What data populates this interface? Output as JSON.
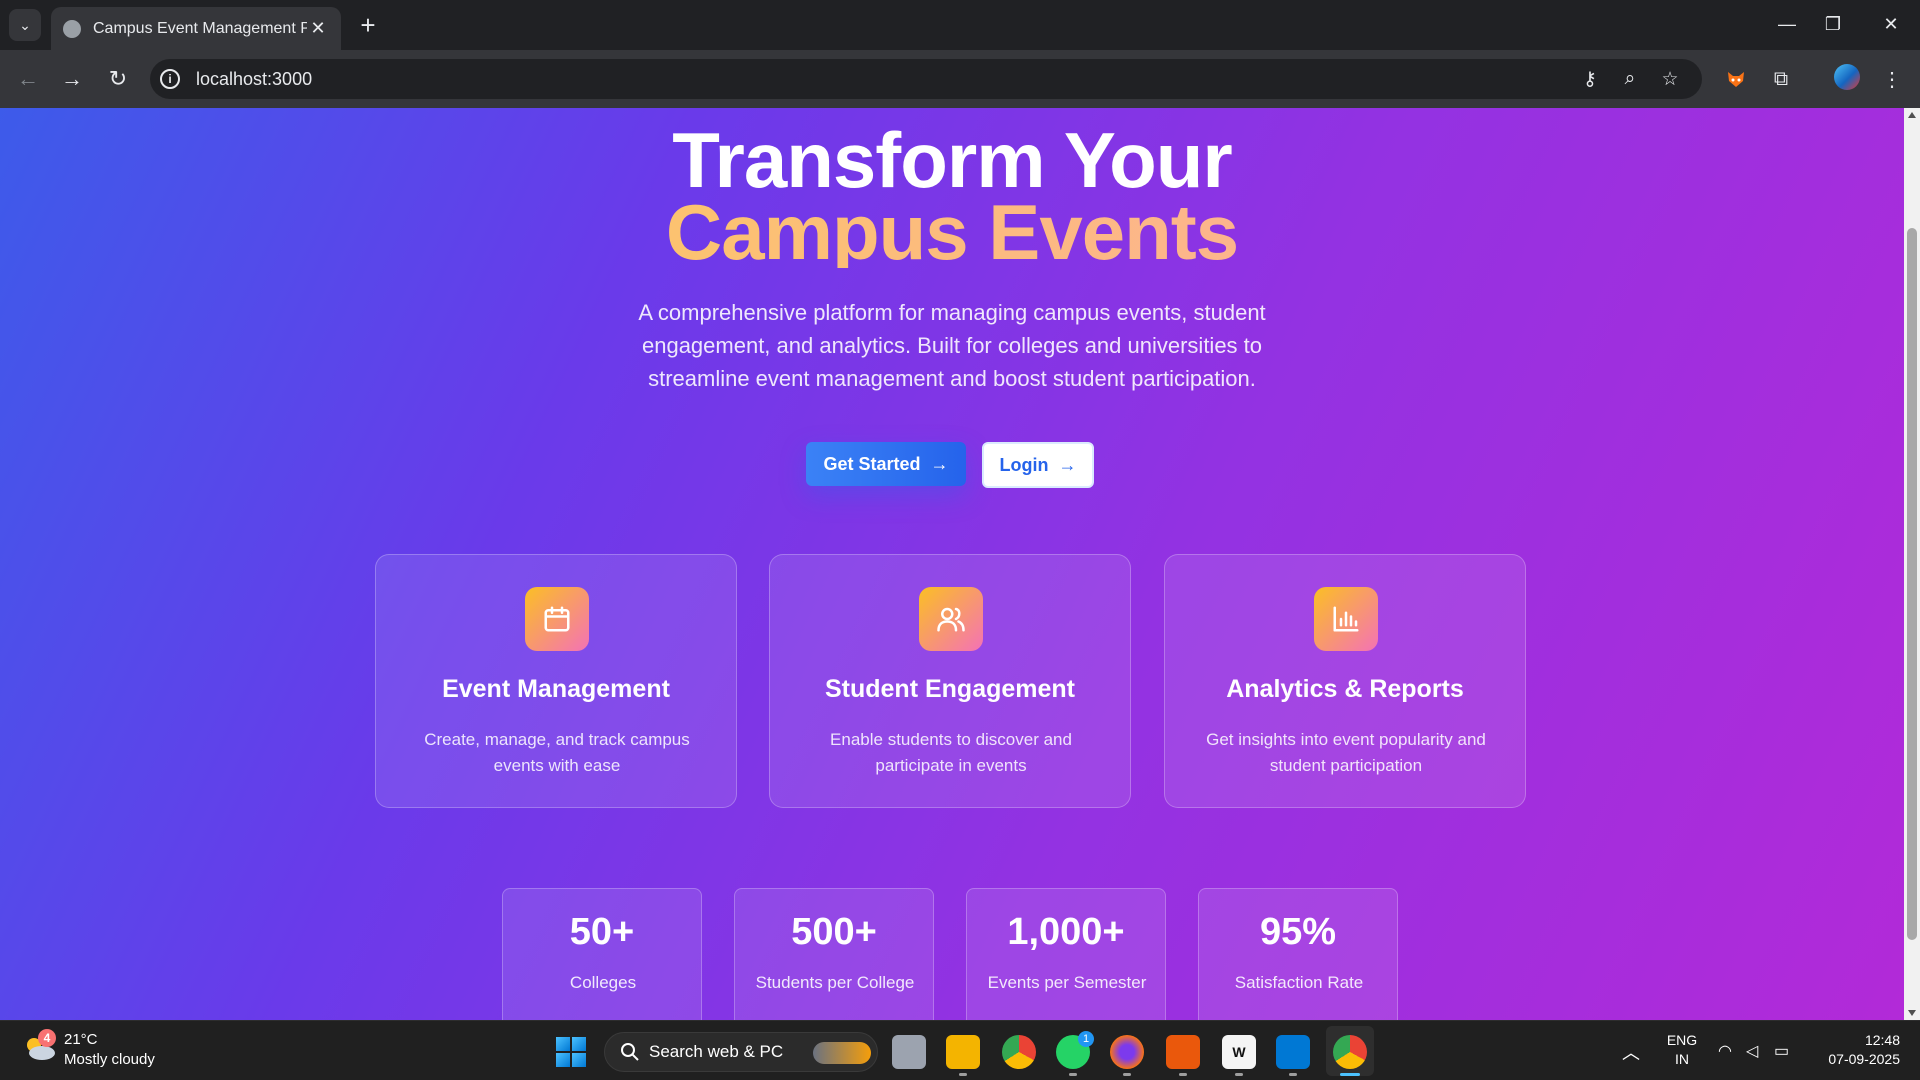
{
  "browser": {
    "tab_title": "Campus Event Management Pla",
    "url": "localhost:3000"
  },
  "hero": {
    "title_line1": "Transform Your",
    "title_line2": "Campus Events",
    "description": "A comprehensive platform for managing campus events, student engagement, and analytics. Built for colleges and universities to streamline event management and boost student participation.",
    "primary_button": "Get Started",
    "secondary_button": "Login"
  },
  "features": [
    {
      "icon": "calendar-icon",
      "title": "Event Management",
      "description": "Create, manage, and track campus events with ease"
    },
    {
      "icon": "users-icon",
      "title": "Student Engagement",
      "description": "Enable students to discover and participate in events"
    },
    {
      "icon": "bar-chart-icon",
      "title": "Analytics & Reports",
      "description": "Get insights into event popularity and student participation"
    }
  ],
  "stats": [
    {
      "value": "50+",
      "label": "Colleges"
    },
    {
      "value": "500+",
      "label": "Students per College"
    },
    {
      "value": "1,000+",
      "label": "Events per Semester"
    },
    {
      "value": "95%",
      "label": "Satisfaction Rate"
    }
  ],
  "taskbar": {
    "weather_badge": "4",
    "temperature": "21°C",
    "condition": "Mostly cloudy",
    "search_placeholder": "Search web & PC",
    "whatsapp_badge": "1",
    "lang_line1": "ENG",
    "lang_line2": "IN",
    "time": "12:48",
    "date": "07-09-2025"
  },
  "colors": {
    "accent_blue": "#2563eb",
    "gradient_start": "#3d5bea",
    "gradient_end": "#b22ad8",
    "highlight_yellow": "#fcd34d",
    "highlight_pink": "#fda4af"
  }
}
